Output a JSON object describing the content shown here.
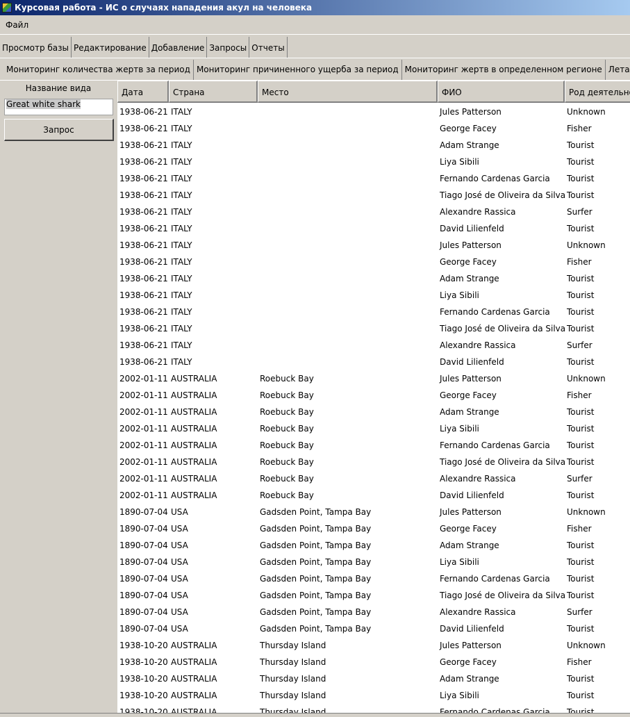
{
  "window": {
    "title": "Курсовая работа - ИС о случаях нападения акул на человека"
  },
  "menu": {
    "file": "Файл"
  },
  "main_tabs": [
    "Просмотр базы",
    "Редактирование",
    "Добавление",
    "Запросы",
    "Отчеты"
  ],
  "sub_tabs": [
    "Мониторинг количества жертв за период",
    "Мониторинг причиненного ущерба за период",
    "Мониторинг жертв в определенном регионе",
    "Летальные исх"
  ],
  "left_panel": {
    "label": "Название вида",
    "species_value": "Great white shark",
    "query_button": "Запрос"
  },
  "table": {
    "columns": [
      "Дата",
      "Страна",
      "Место",
      "ФИО",
      "Род деятельно"
    ],
    "rows": [
      [
        "1938-06-21",
        "ITALY",
        "",
        "Jules Patterson",
        "Unknown"
      ],
      [
        "1938-06-21",
        "ITALY",
        "",
        "George Facey",
        "Fisher"
      ],
      [
        "1938-06-21",
        "ITALY",
        "",
        "Adam Strange",
        "Tourist"
      ],
      [
        "1938-06-21",
        "ITALY",
        "",
        "Liya Sibili",
        "Tourist"
      ],
      [
        "1938-06-21",
        "ITALY",
        "",
        "Fernando Cardenas Garcia",
        "Tourist"
      ],
      [
        "1938-06-21",
        "ITALY",
        "",
        "Tiago José de Oliveira da Silva",
        "Tourist"
      ],
      [
        "1938-06-21",
        "ITALY",
        "",
        "Alexandre Rassica",
        "Surfer"
      ],
      [
        "1938-06-21",
        "ITALY",
        "",
        "David Lilienfeld",
        "Tourist"
      ],
      [
        "1938-06-21",
        "ITALY",
        "",
        "Jules Patterson",
        "Unknown"
      ],
      [
        "1938-06-21",
        "ITALY",
        "",
        "George Facey",
        "Fisher"
      ],
      [
        "1938-06-21",
        "ITALY",
        "",
        "Adam Strange",
        "Tourist"
      ],
      [
        "1938-06-21",
        "ITALY",
        "",
        "Liya Sibili",
        "Tourist"
      ],
      [
        "1938-06-21",
        "ITALY",
        "",
        "Fernando Cardenas Garcia",
        "Tourist"
      ],
      [
        "1938-06-21",
        "ITALY",
        "",
        "Tiago José de Oliveira da Silva",
        "Tourist"
      ],
      [
        "1938-06-21",
        "ITALY",
        "",
        "Alexandre Rassica",
        "Surfer"
      ],
      [
        "1938-06-21",
        "ITALY",
        "",
        "David Lilienfeld",
        "Tourist"
      ],
      [
        "2002-01-11",
        "AUSTRALIA",
        "Roebuck Bay",
        "Jules Patterson",
        "Unknown"
      ],
      [
        "2002-01-11",
        "AUSTRALIA",
        "Roebuck Bay",
        "George Facey",
        "Fisher"
      ],
      [
        "2002-01-11",
        "AUSTRALIA",
        "Roebuck Bay",
        "Adam Strange",
        "Tourist"
      ],
      [
        "2002-01-11",
        "AUSTRALIA",
        "Roebuck Bay",
        "Liya Sibili",
        "Tourist"
      ],
      [
        "2002-01-11",
        "AUSTRALIA",
        "Roebuck Bay",
        "Fernando Cardenas Garcia",
        "Tourist"
      ],
      [
        "2002-01-11",
        "AUSTRALIA",
        "Roebuck Bay",
        "Tiago José de Oliveira da Silva",
        "Tourist"
      ],
      [
        "2002-01-11",
        "AUSTRALIA",
        "Roebuck Bay",
        "Alexandre Rassica",
        "Surfer"
      ],
      [
        "2002-01-11",
        "AUSTRALIA",
        "Roebuck Bay",
        "David Lilienfeld",
        "Tourist"
      ],
      [
        "1890-07-04",
        "USA",
        "Gadsden Point, Tampa Bay",
        "Jules Patterson",
        "Unknown"
      ],
      [
        "1890-07-04",
        "USA",
        "Gadsden Point, Tampa Bay",
        "George Facey",
        "Fisher"
      ],
      [
        "1890-07-04",
        "USA",
        "Gadsden Point, Tampa Bay",
        "Adam Strange",
        "Tourist"
      ],
      [
        "1890-07-04",
        "USA",
        "Gadsden Point, Tampa Bay",
        "Liya Sibili",
        "Tourist"
      ],
      [
        "1890-07-04",
        "USA",
        "Gadsden Point, Tampa Bay",
        "Fernando Cardenas Garcia",
        "Tourist"
      ],
      [
        "1890-07-04",
        "USA",
        "Gadsden Point, Tampa Bay",
        "Tiago José de Oliveira da Silva",
        "Tourist"
      ],
      [
        "1890-07-04",
        "USA",
        "Gadsden Point, Tampa Bay",
        "Alexandre Rassica",
        "Surfer"
      ],
      [
        "1890-07-04",
        "USA",
        "Gadsden Point, Tampa Bay",
        "David Lilienfeld",
        "Tourist"
      ],
      [
        "1938-10-20",
        "AUSTRALIA",
        "Thursday Island",
        "Jules Patterson",
        "Unknown"
      ],
      [
        "1938-10-20",
        "AUSTRALIA",
        "Thursday Island",
        "George Facey",
        "Fisher"
      ],
      [
        "1938-10-20",
        "AUSTRALIA",
        "Thursday Island",
        "Adam Strange",
        "Tourist"
      ],
      [
        "1938-10-20",
        "AUSTRALIA",
        "Thursday Island",
        "Liya Sibili",
        "Tourist"
      ],
      [
        "1938-10-20",
        "AUSTRALIA",
        "Thursday Island",
        "Fernando Cardenas Garcia",
        "Tourist"
      ]
    ]
  }
}
